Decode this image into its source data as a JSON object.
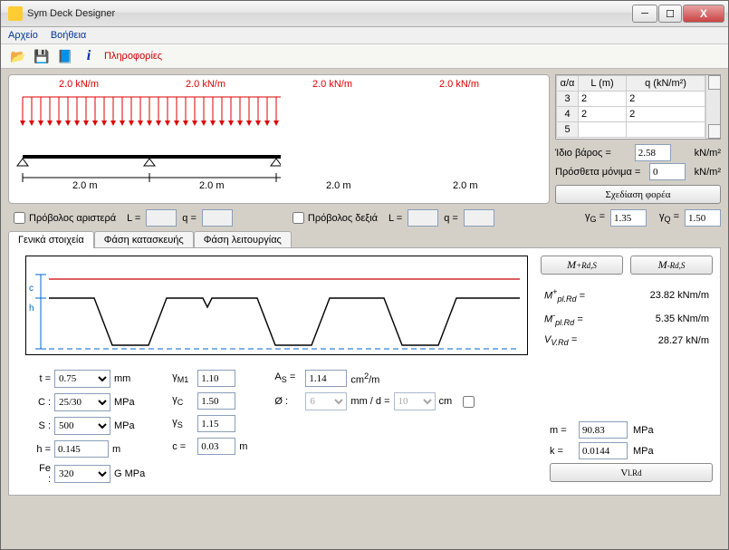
{
  "window": {
    "title": "Sym Deck Designer"
  },
  "menu": {
    "file": "Αρχείο",
    "help": "Βοήθεια"
  },
  "toolbar": {
    "info_label": "Πληροφορίες"
  },
  "beam": {
    "load_labels": [
      "2.0 kN/m",
      "2.0 kN/m",
      "2.0 kN/m",
      "2.0 kN/m"
    ],
    "span_labels": [
      "2.0 m",
      "2.0 m",
      "2.0 m",
      "2.0 m"
    ]
  },
  "spans_table": {
    "headers": {
      "idx": "α/α",
      "L": "L (m)",
      "q": "q (kN/m²)"
    },
    "rows": [
      {
        "idx": "3",
        "L": "2",
        "q": "2"
      },
      {
        "idx": "4",
        "L": "2",
        "q": "2"
      },
      {
        "idx": "5",
        "L": "",
        "q": ""
      }
    ]
  },
  "loads": {
    "self_weight_label": "Ίδιο βάρος =",
    "self_weight_value": "2.58",
    "sw_unit": "kN/m²",
    "extra_label": "Πρόσθετα μόνιμα =",
    "extra_value": "0",
    "extra_unit": "kN/m²",
    "redesign_label": "Σχεδίαση φορέα",
    "gammaG_label": "γG =",
    "gammaG_value": "1.35",
    "gammaQ_label": "γQ =",
    "gammaQ_value": "1.50"
  },
  "cantilever": {
    "left_label": "Πρόβολος αριστερά",
    "right_label": "Πρόβολος δεξιά",
    "L_label": "L =",
    "q_label": "q =",
    "left_L": "",
    "left_q": "",
    "right_L": "",
    "right_q": ""
  },
  "tabs": {
    "t1": "Γενικά στοιχεία",
    "t2": "Φάση κατασκευής",
    "t3": "Φάση λειτουργίας"
  },
  "props": {
    "t_label": "t =",
    "t_value": "0.75",
    "t_unit": "mm",
    "C_label": "C :",
    "C_value": "25/30",
    "C_unit": "MPa",
    "S_label": "S :",
    "S_value": "500",
    "S_unit": "MPa",
    "h_label": "h =",
    "h_value": "0.145",
    "h_unit": "m",
    "Fe_label": "Fe :",
    "Fe_value": "320",
    "Fe_unit": "G MPa",
    "gM1_label": "γM1",
    "gM1_value": "1.10",
    "gC_label": "γC",
    "gC_value": "1.50",
    "gS_label": "γS",
    "gS_value": "1.15",
    "c_label": "c =",
    "c_value": "0.03",
    "c_unit": "m",
    "As_label": "AS =",
    "As_value": "1.14",
    "As_unit": "cm²/m",
    "dia_label": "Ø :",
    "dia_value": "6",
    "d_sep": "mm / d =",
    "d_value": "10",
    "d_unit": "cm"
  },
  "results": {
    "btn_plus": "M⁺Rd,S",
    "btn_minus": "M⁻Rd,S",
    "r1_label": "M⁺pl.Rd =",
    "r1_val": "23.82 kNm/m",
    "r2_label": "M⁻pl.Rd =",
    "r2_val": "5.35 kNm/m",
    "r3_label": "VV.Rd =",
    "r3_val": "28.27 kN/m",
    "m_label": "m =",
    "m_val": "90.83",
    "m_unit": "MPa",
    "k_label": "k =",
    "k_val": "0.0144",
    "k_unit": "MPa",
    "vlr_label": "V l.Rd"
  }
}
